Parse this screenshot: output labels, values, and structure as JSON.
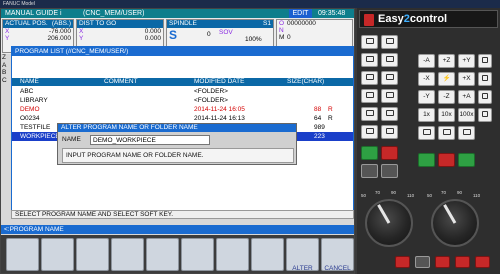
{
  "window_title": "FANUC Model",
  "header": {
    "mode": "MANUAL GUIDE i",
    "path": "(CNC_MEM/USER)",
    "edit_label": "EDIT",
    "clock": "09:35:48"
  },
  "actual_pos": {
    "title": "ACTUAL POS.",
    "mode": "(ABS.)",
    "rows": [
      {
        "axis": "X",
        "value": "-76.000"
      },
      {
        "axis": "Y",
        "value": "206.000"
      }
    ]
  },
  "dist_to_go": {
    "title": "DIST TO GO",
    "rows": [
      {
        "axis": "X",
        "value": "0.000"
      },
      {
        "axis": "Y",
        "value": "0.000"
      }
    ]
  },
  "spindle": {
    "title": "SPINDLE",
    "spindle_id": "S1",
    "s_label": "S",
    "s_value": "0",
    "sov_label": "SOV",
    "sov_value": "100%"
  },
  "onm": {
    "o_label": "O",
    "o_value": "00000000",
    "n_label": "N",
    "m_label": "M",
    "m_value": "0"
  },
  "side_letters": [
    "Z",
    "A",
    "B",
    "C"
  ],
  "program_list": {
    "title": "PROGRAM LIST (//CNC_MEM/USER/)",
    "columns": {
      "name": "NAME",
      "comment": "COMMENT",
      "modified": "MODIFIED DATE",
      "size": "SIZE(CHAR)"
    },
    "rows": [
      {
        "name": "ABC",
        "comment": "",
        "modified": "<FOLDER>",
        "size": "",
        "flag": ""
      },
      {
        "name": "LIBRARY",
        "comment": "",
        "modified": "<FOLDER>",
        "size": "",
        "flag": ""
      },
      {
        "name": "DEMO",
        "comment": "",
        "modified": "2014-11-24 16:05",
        "size": "88",
        "flag": "R"
      },
      {
        "name": "O0234",
        "comment": "",
        "modified": "2014-11-24 16:13",
        "size": "64",
        "flag": "R"
      },
      {
        "name": "TESTFILE",
        "comment": "",
        "modified": "",
        "size": "989",
        "flag": ""
      },
      {
        "name": "WORKPIECE",
        "comment": "",
        "modified": "",
        "size": "223",
        "flag": ""
      }
    ]
  },
  "dialog": {
    "title": "ALTER PROGRAM NAME OR FOLDER NAME",
    "name_label": "NAME",
    "name_value": "DEMO_WORKPIECE",
    "hint": "INPUT PROGRAM NAME OR FOLDER NAME."
  },
  "message": "SELECT PROGRAM NAME AND SELECT SOFT KEY.",
  "soft_key_bar": "<:PROGRAM NAME",
  "soft_keys": [
    "",
    "",
    "",
    "",
    "",
    "",
    "",
    "",
    "ALTER",
    "CANCEL"
  ],
  "panel": {
    "logo_text_a": "Easy",
    "logo_text_b": "2",
    "logo_text_c": "control",
    "keys": [
      "-A",
      "+Z",
      "+Y",
      "-X",
      "+X",
      "-Y",
      "-Z",
      "+A",
      "1x",
      "10x",
      "100x"
    ],
    "feed_scale": [
      "50",
      "60",
      "70",
      "80",
      "90",
      "100",
      "110",
      "120"
    ],
    "spindle_scale": [
      "50",
      "60",
      "70",
      "80",
      "90",
      "100",
      "110",
      "120"
    ]
  },
  "colors": {
    "header_teal": "#0e7e8c",
    "panel_blue": "#0b68a6",
    "dialog_blue": "#1a6bd0",
    "selected_row": "#1a3fc9",
    "alert_red": "#d40000"
  }
}
